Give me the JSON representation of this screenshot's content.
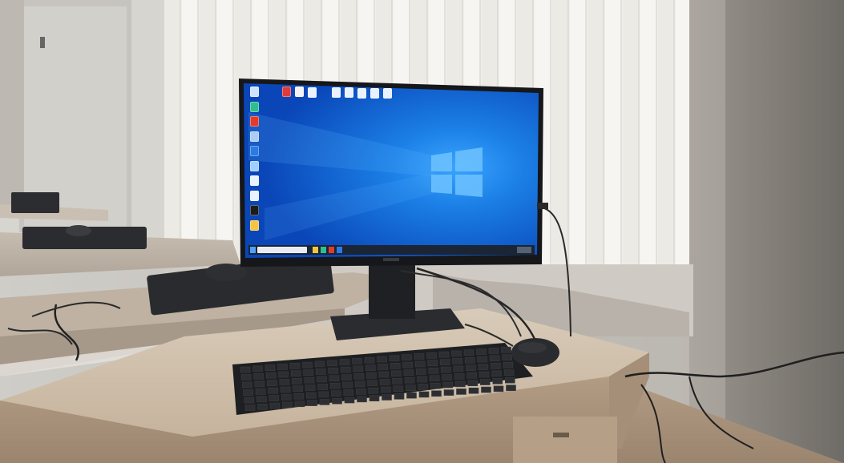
{
  "scene": {
    "screen_color": "#0a5fd6",
    "screen_glow": "#37a6ff",
    "wall_color": "#d9d7d2",
    "blind_color": "#f4f2ee",
    "desk_color": "#cbb9a3",
    "equipment_color": "#232427"
  },
  "desktop_icons": [
    {
      "name": "recycle-bin-icon",
      "color": "#cfe3ff"
    },
    {
      "name": "edge-icon",
      "color": "#2fbf8f"
    },
    {
      "name": "app-red-icon",
      "color": "#e23b2e"
    },
    {
      "name": "network-icon",
      "color": "#a9cdf5"
    },
    {
      "name": "yandex-icon",
      "color": "#2a7be4"
    },
    {
      "name": "folder-icon",
      "color": "#9ed0ff"
    },
    {
      "name": "document-icon",
      "color": "#e9f2ff"
    },
    {
      "name": "document-icon-2",
      "color": "#e9f2ff"
    },
    {
      "name": "k-app-icon",
      "color": "#1b1b1b"
    },
    {
      "name": "folder-yellow-icon",
      "color": "#f5c542"
    }
  ],
  "top_icons": [
    {
      "name": "pdf-file-icon",
      "color": "#e03a3a"
    },
    {
      "name": "text-file-icon",
      "color": "#f3f3f3"
    },
    {
      "name": "word-file-icon",
      "color": "#e9f2ff"
    },
    {
      "name": "file-icon-1",
      "color": "#e9f2ff"
    },
    {
      "name": "file-icon-2",
      "color": "#e9f2ff"
    },
    {
      "name": "file-icon-3",
      "color": "#e9f2ff"
    },
    {
      "name": "file-icon-4",
      "color": "#e9f2ff"
    },
    {
      "name": "file-icon-5",
      "color": "#e9f2ff"
    }
  ]
}
